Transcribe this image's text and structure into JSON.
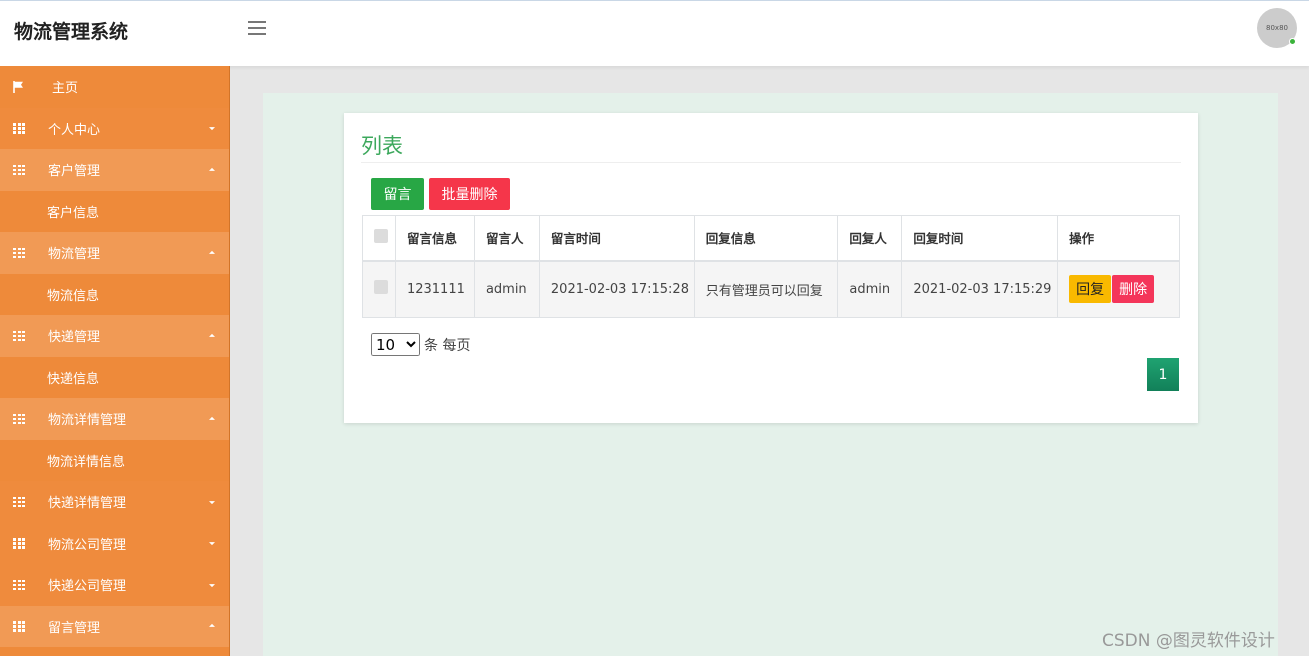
{
  "header": {
    "app_title": "物流管理系统",
    "avatar_text": "80x80"
  },
  "sidebar": {
    "items": [
      {
        "label": "主页",
        "kind": "home"
      },
      {
        "label": "个人中心",
        "kind": "parent",
        "state": "collapsed"
      },
      {
        "label": "客户管理",
        "kind": "parent",
        "state": "expanded"
      },
      {
        "label": "客户信息",
        "kind": "sub"
      },
      {
        "label": "物流管理",
        "kind": "parent",
        "state": "expanded"
      },
      {
        "label": "物流信息",
        "kind": "sub"
      },
      {
        "label": "快递管理",
        "kind": "parent",
        "state": "expanded"
      },
      {
        "label": "快递信息",
        "kind": "sub"
      },
      {
        "label": "物流详情管理",
        "kind": "parent",
        "state": "expanded"
      },
      {
        "label": "物流详情信息",
        "kind": "sub"
      },
      {
        "label": "快递详情管理",
        "kind": "parent",
        "state": "collapsed"
      },
      {
        "label": "物流公司管理",
        "kind": "parent",
        "state": "collapsed"
      },
      {
        "label": "快递公司管理",
        "kind": "parent",
        "state": "collapsed"
      },
      {
        "label": "留言管理",
        "kind": "parent",
        "state": "expanded"
      }
    ]
  },
  "main": {
    "card_title": "列表",
    "toolbar": {
      "leave_message_label": "留言",
      "batch_delete_label": "批量删除"
    },
    "table": {
      "headers": [
        "留言信息",
        "留言人",
        "留言时间",
        "回复信息",
        "回复人",
        "回复时间",
        "操作"
      ],
      "rows": [
        {
          "message": "1231111",
          "author": "admin",
          "message_time": "2021-02-03 17:15:28",
          "reply": "只有管理员可以回复",
          "replier": "admin",
          "reply_time": "2021-02-03 17:15:29",
          "reply_button": "回复",
          "delete_button": "删除"
        }
      ]
    },
    "pager": {
      "page_size_value": "10",
      "page_size_suffix": "条 每页",
      "current_page": "1"
    }
  },
  "watermark": "CSDN @图灵软件设计",
  "colors": {
    "sidebar": "#ee8a3a",
    "accent_green": "#28a745",
    "danger": "#f5364a",
    "warning": "#f9b900",
    "title_green": "#3ca85c"
  }
}
